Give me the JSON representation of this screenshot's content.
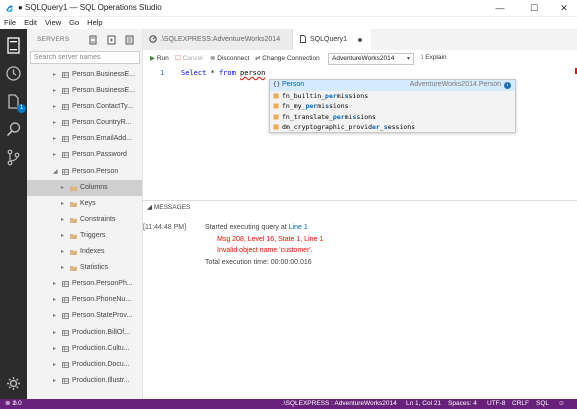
{
  "window": {
    "title": "● SQLQuery1 — SQL Operations Studio",
    "controls": [
      "minimize-icon",
      "maximize-icon",
      "close-icon"
    ]
  },
  "menu": [
    "File",
    "Edit",
    "View",
    "Go",
    "Help"
  ],
  "activity_bar": {
    "items": [
      "servers-icon",
      "history-icon",
      "task-icon",
      "search-icon",
      "git-icon"
    ],
    "badge": "1",
    "settings": "gear-icon"
  },
  "sidebar": {
    "title": "SERVERS",
    "search_placeholder": "Search server names",
    "tree": [
      {
        "label": "Person.BusinessE...",
        "level": 1,
        "kind": "table",
        "twisty": "▸"
      },
      {
        "label": "Person.BusinessE...",
        "level": 1,
        "kind": "table",
        "twisty": "▸"
      },
      {
        "label": "Person.ContactTy...",
        "level": 1,
        "kind": "table",
        "twisty": "▸"
      },
      {
        "label": "Person.CountryR...",
        "level": 1,
        "kind": "table",
        "twisty": "▸"
      },
      {
        "label": "Person.EmailAdd...",
        "level": 1,
        "kind": "table",
        "twisty": "▸"
      },
      {
        "label": "Person.Password",
        "level": 1,
        "kind": "table",
        "twisty": "▸"
      },
      {
        "label": "Person.Person",
        "level": 1,
        "kind": "table",
        "twisty": "◢"
      },
      {
        "label": "Columns",
        "level": 2,
        "kind": "folder",
        "twisty": "▸",
        "selected": true
      },
      {
        "label": "Keys",
        "level": 2,
        "kind": "folder",
        "twisty": "▸"
      },
      {
        "label": "Constraints",
        "level": 2,
        "kind": "folder",
        "twisty": "▸"
      },
      {
        "label": "Triggers",
        "level": 2,
        "kind": "folder",
        "twisty": "▸"
      },
      {
        "label": "Indexes",
        "level": 2,
        "kind": "folder",
        "twisty": "▸"
      },
      {
        "label": "Statistics",
        "level": 2,
        "kind": "folder",
        "twisty": "▸"
      },
      {
        "label": "Person.PersonPh...",
        "level": 1,
        "kind": "table",
        "twisty": "▸"
      },
      {
        "label": "Person.PhoneNu...",
        "level": 1,
        "kind": "table",
        "twisty": "▸"
      },
      {
        "label": "Person.StateProv...",
        "level": 1,
        "kind": "table",
        "twisty": "▸"
      },
      {
        "label": "Production.BillOf...",
        "level": 1,
        "kind": "table",
        "twisty": "▸"
      },
      {
        "label": "Production.Cultu...",
        "level": 1,
        "kind": "table",
        "twisty": "▸"
      },
      {
        "label": "Production.Docu...",
        "level": 1,
        "kind": "table",
        "twisty": "▸"
      },
      {
        "label": "Production.Illustr...",
        "level": 1,
        "kind": "table",
        "twisty": "▸"
      }
    ]
  },
  "tabs": [
    {
      "label": ".\\SQLEXPRESS:AdventureWorks2014",
      "active": false
    },
    {
      "label": "SQLQuery1",
      "active": true,
      "dirty": true
    }
  ],
  "toolbar": {
    "run": "Run",
    "cancel": "Cancel",
    "disconnect": "Disconnect",
    "change_connection": "Change Connection",
    "database": "AdventureWorks2014",
    "explain": "Explain"
  },
  "editor": {
    "line_number": "1",
    "code": {
      "kw1": "Select",
      "mid": " * ",
      "kw2": "from",
      "space": " ",
      "obj": "person"
    }
  },
  "suggestions": [
    {
      "label": "Person",
      "detail": "AdventureWorks2014.Person",
      "kind": "object"
    },
    {
      "pre": "fn_builtin_",
      "hl": "per",
      "mid": "mi",
      "hl2": "s",
      "post": "sions",
      "kind": "function"
    },
    {
      "pre": "fn_my_",
      "hl": "per",
      "mid": "mi",
      "hl2": "s",
      "post": "sions",
      "kind": "function"
    },
    {
      "pre": "fn_translate_",
      "hl": "per",
      "mid": "mi",
      "hl2": "s",
      "post": "sions",
      "kind": "function"
    },
    {
      "pre": "dm_cryptographic_provid",
      "hl": "er",
      "mid": "_",
      "hl2": "s",
      "post": "essions",
      "kind": "function"
    }
  ],
  "messages": {
    "header": "MESSAGES",
    "time": "[11:44:48 PM]",
    "started_prefix": "Started executing query at ",
    "started_link": "Line 1",
    "error1": "Msg 208, Level 16, State 1, Line 1",
    "error2": "Invalid object name 'customer'.",
    "total": "Total execution time: 00:00:00.016"
  },
  "status_bar": {
    "errors": "1",
    "warnings": "0",
    "connection": ".\\SQLEXPRESS : AdventureWorks2014",
    "position": "Ln 1, Col 21",
    "spaces": "Spaces: 4",
    "encoding": "UTF-8",
    "eol": "CRLF",
    "language": "SQL"
  },
  "colors": {
    "activity_bar": "#2c2c2c",
    "status_bar": "#68217a",
    "accent": "#007acc",
    "error": "#e51400"
  }
}
